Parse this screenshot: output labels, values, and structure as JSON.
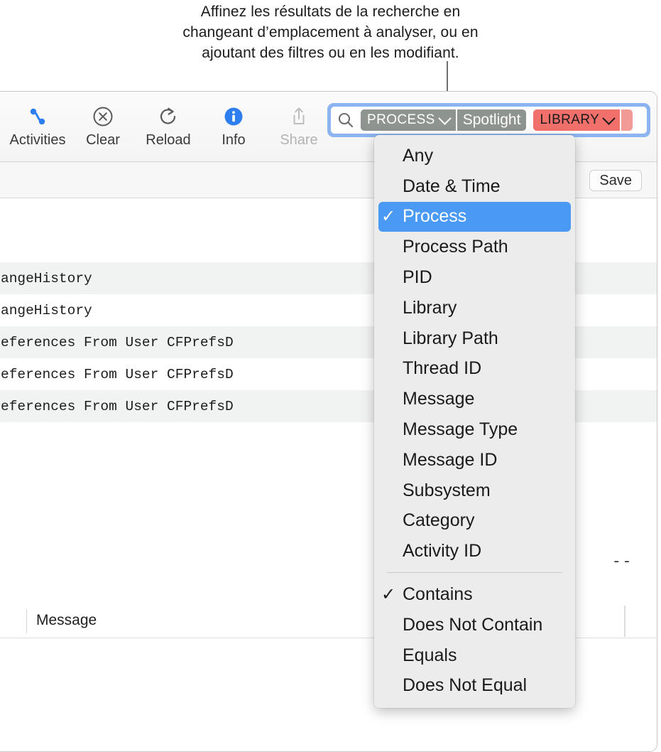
{
  "callout": {
    "lines": [
      "Affinez les résultats de la recherche en",
      "changeant d’emplacement à analyser, ou en",
      "ajoutant des filtres ou en les modifiant."
    ]
  },
  "toolbar": {
    "buttons": [
      {
        "label": "Activities",
        "icon": "activities-icon",
        "disabled": false
      },
      {
        "label": "Clear",
        "icon": "clear-circle-x-icon",
        "disabled": false
      },
      {
        "label": "Reload",
        "icon": "reload-icon",
        "disabled": false
      },
      {
        "label": "Info",
        "icon": "info-icon",
        "disabled": false
      },
      {
        "label": "Share",
        "icon": "share-icon",
        "disabled": true
      }
    ]
  },
  "search": {
    "icon": "search-icon",
    "tokens": [
      {
        "name": "field-token",
        "label": "PROCESS",
        "has_chevron": true,
        "color": "#8e9490",
        "text_color": "#ffffff"
      },
      {
        "name": "value-token",
        "label": "Spotlight",
        "has_chevron": false,
        "color": "#8e9490",
        "text_color": "#ffffff"
      },
      {
        "name": "library-token",
        "label": "LIBRARY",
        "has_chevron": true,
        "color": "#f2706c",
        "text_color": "#1a1a1a"
      },
      {
        "name": "library-value-token",
        "label": "",
        "has_chevron": false,
        "color": "#f29a96",
        "text_color": "#1a1a1a"
      }
    ],
    "focus_ring_color": "#8cb4f0"
  },
  "filterbar": {
    "save_label": "Save"
  },
  "log_rows": [
    {
      "text": "",
      "alt": false
    },
    {
      "text": "",
      "alt": false
    },
    {
      "text": "angeHistory",
      "alt": true
    },
    {
      "text": "angeHistory",
      "alt": false
    },
    {
      "text": "eferences From User CFPrefsD",
      "alt": true
    },
    {
      "text": "eferences From User CFPrefsD",
      "alt": false
    },
    {
      "text": "eferences From User CFPrefsD",
      "alt": true
    },
    {
      "text": "",
      "alt": false
    }
  ],
  "detail": {
    "dashes": "--",
    "message_column_label": "Message"
  },
  "menu": {
    "highlight_color": "#4a9af4",
    "background_color": "#ececec",
    "check_glyph": "✓",
    "groups": [
      {
        "items": [
          {
            "label": "Any",
            "checked": false,
            "selected": false
          },
          {
            "label": "Date & Time",
            "checked": false,
            "selected": false
          },
          {
            "label": "Process",
            "checked": true,
            "selected": true
          },
          {
            "label": "Process Path",
            "checked": false,
            "selected": false
          },
          {
            "label": "PID",
            "checked": false,
            "selected": false
          },
          {
            "label": "Library",
            "checked": false,
            "selected": false
          },
          {
            "label": "Library Path",
            "checked": false,
            "selected": false
          },
          {
            "label": "Thread ID",
            "checked": false,
            "selected": false
          },
          {
            "label": "Message",
            "checked": false,
            "selected": false
          },
          {
            "label": "Message Type",
            "checked": false,
            "selected": false
          },
          {
            "label": "Message ID",
            "checked": false,
            "selected": false
          },
          {
            "label": "Subsystem",
            "checked": false,
            "selected": false
          },
          {
            "label": "Category",
            "checked": false,
            "selected": false
          },
          {
            "label": "Activity ID",
            "checked": false,
            "selected": false
          }
        ]
      },
      {
        "items": [
          {
            "label": "Contains",
            "checked": true,
            "selected": false
          },
          {
            "label": "Does Not Contain",
            "checked": false,
            "selected": false
          },
          {
            "label": "Equals",
            "checked": false,
            "selected": false
          },
          {
            "label": "Does Not Equal",
            "checked": false,
            "selected": false
          }
        ]
      }
    ]
  }
}
